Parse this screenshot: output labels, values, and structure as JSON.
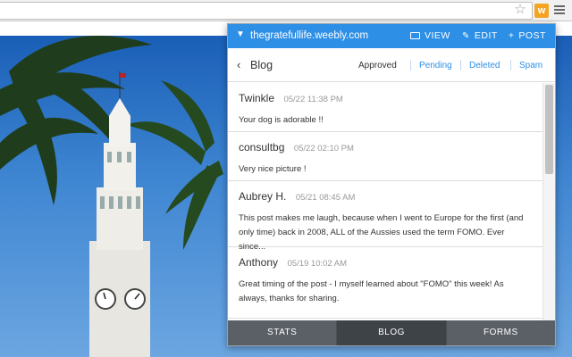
{
  "browser": {
    "star_icon": "star-icon",
    "extension_icon_label": "w",
    "menu_icon": "hamburger-icon"
  },
  "popup": {
    "site_name": "thegratefullife.weebly.com",
    "actions": {
      "view": "VIEW",
      "edit": "EDIT",
      "post": "POST"
    },
    "section_title": "Blog",
    "filters": {
      "approved": "Approved",
      "pending": "Pending",
      "deleted": "Deleted",
      "spam": "Spam"
    },
    "comments": [
      {
        "author": "Twinkle",
        "time": "05/22 11:38 PM",
        "body": "Your dog is adorable !!"
      },
      {
        "author": "consultbg",
        "time": "05/22 02:10 PM",
        "body": "Very nice picture !"
      },
      {
        "author": "Aubrey H.",
        "time": "05/21 08:45 AM",
        "body": "This post makes me laugh, because when I went to Europe for the first (and only time) back in 2008, ALL of the Aussies used the term FOMO. Ever since..."
      },
      {
        "author": "Anthony",
        "time": "05/19 10:02 AM",
        "body": "Great timing of the post - I myself learned about \"FOMO\" this week! As always, thanks for sharing."
      }
    ],
    "tabs": {
      "stats": "STATS",
      "blog": "BLOG",
      "forms": "FORMS"
    },
    "colors": {
      "accent": "#2d8fe6",
      "tab_bg": "#5b6066",
      "tab_active_bg": "#3e4348"
    }
  }
}
